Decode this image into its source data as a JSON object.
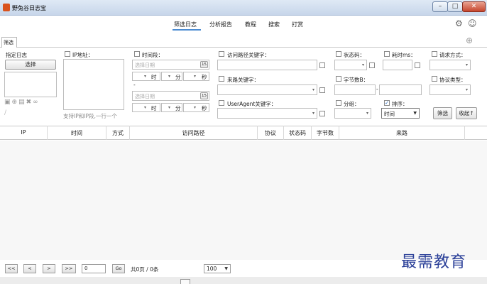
{
  "window": {
    "title": "野兔谷日志宝",
    "min_symbol": "–",
    "max_symbol": "□",
    "close_symbol": "✕"
  },
  "menu": {
    "items": [
      "筛选日志",
      "分析报告",
      "教程",
      "搜索",
      "打赏"
    ],
    "settings_icon": "gear-icon",
    "feedback_icon": "smiley-icon"
  },
  "tab": {
    "label": "筛选",
    "add_icon": "plus-circle-icon"
  },
  "filter": {
    "log_label": "指定日志",
    "select_button": "选择",
    "log_actions": [
      "select-all-icon",
      "add-icon",
      "chart-icon",
      "clear-icon",
      "link-icon",
      "unlink-icon"
    ],
    "ip_label": "IP地址：",
    "ip_hint": "支持IP和IP段,一行一个",
    "time_label": "时间段：",
    "date_placeholder": "选择日期",
    "calendar_text": "15",
    "hour_unit": "时",
    "minute_unit": "分",
    "second_unit": "秒",
    "range_sep": "-",
    "path_label": "访问路径关键字：",
    "referer_label": "来路关键字：",
    "ua_label": "UserAgent关键字：",
    "status_label": "状态码：",
    "bytes_label": "字节数B：",
    "group_label": "分组：",
    "time_ms_label": "耗时ms：",
    "sort_label": "排序：",
    "sort_value": "时间",
    "method_label": "请求方式：",
    "protocol_label": "协议类型：",
    "filter_button": "筛选",
    "collapse_button": "收起↑"
  },
  "table": {
    "columns": [
      "IP",
      "时间",
      "方式",
      "访问路径",
      "协议",
      "状态码",
      "字节数",
      "来路"
    ]
  },
  "pager": {
    "first": "<<",
    "prev": "<",
    "next": ">",
    "last": ">>",
    "page_value": "0",
    "go": "Go",
    "summary": "共0页 / 0条",
    "page_size": "100"
  },
  "watermark": "最需教育"
}
